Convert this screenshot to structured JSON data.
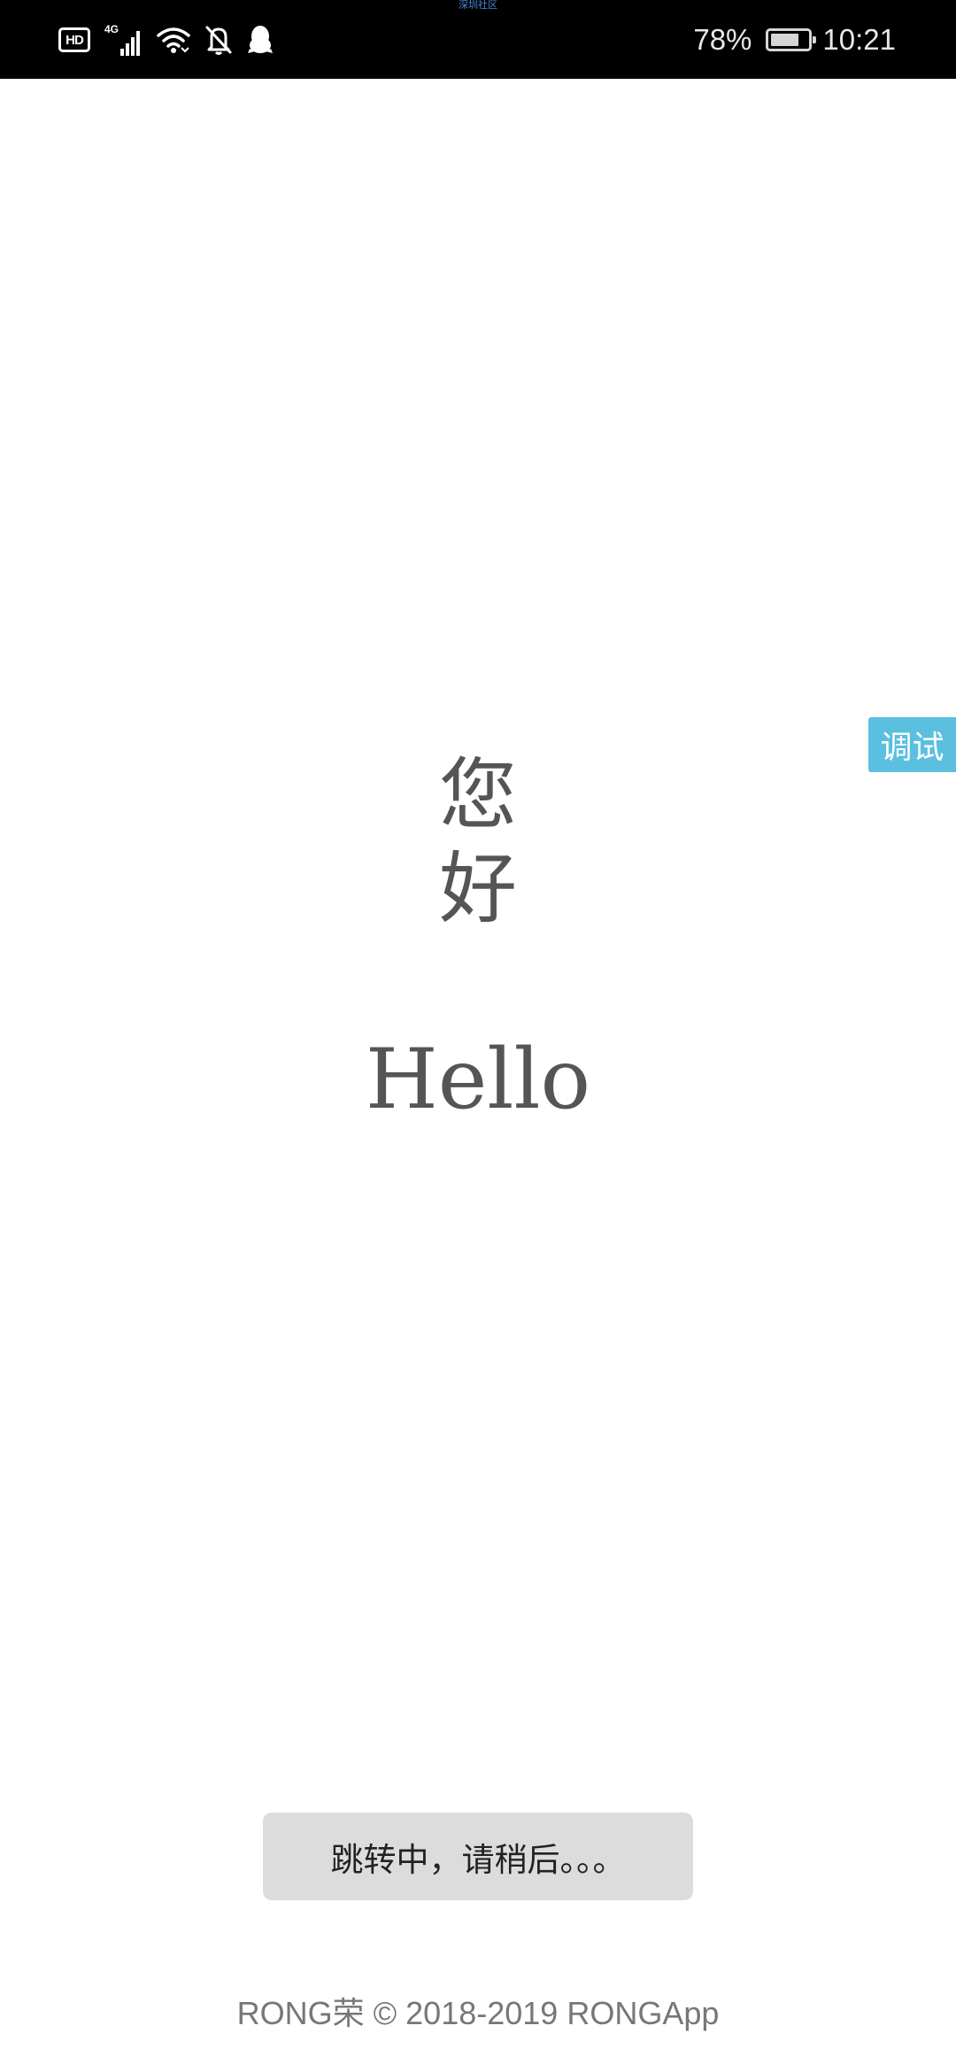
{
  "status_bar": {
    "top_notice": "深圳社区",
    "hd_label": "HD",
    "network_label": "4G",
    "battery_percent": "78%",
    "battery_level": 0.78,
    "time": "10:21",
    "icons": [
      "hd-icon",
      "signal-4g-icon",
      "wifi-icon",
      "bell-off-icon",
      "qq-penguin-icon",
      "battery-icon"
    ]
  },
  "debug_tab": {
    "label": "调试"
  },
  "greeting": {
    "cn_chars": [
      "您",
      "好"
    ],
    "en": "Hello"
  },
  "toast": {
    "message": "跳转中，请稍后。。。"
  },
  "footer": {
    "text": "RONG荣 © 2018-2019 RONGApp"
  },
  "colors": {
    "status_bar_bg": "#000000",
    "debug_tab_bg": "#5bbfe0",
    "text_primary": "#555555",
    "toast_bg": "#dcdcdc",
    "footer_text": "#777777"
  }
}
